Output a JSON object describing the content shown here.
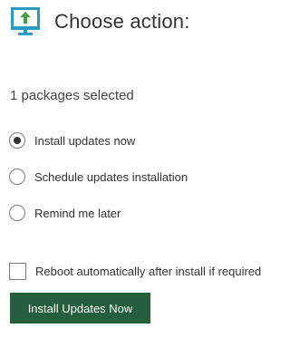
{
  "header": {
    "icon": "monitor-upload-icon",
    "title": "Choose action:",
    "icon_colors": {
      "frame": "#2b9bc6",
      "arrow": "#43a047"
    }
  },
  "selection": {
    "count_text": "1 packages selected"
  },
  "options": [
    {
      "label": "Install updates now",
      "checked": true
    },
    {
      "label": "Schedule updates installation",
      "checked": false
    },
    {
      "label": "Remind me later",
      "checked": false
    }
  ],
  "reboot": {
    "label": "Reboot automatically after install if required",
    "checked": false
  },
  "action_button": {
    "label": "Install Updates Now",
    "color": "#245e3d"
  }
}
